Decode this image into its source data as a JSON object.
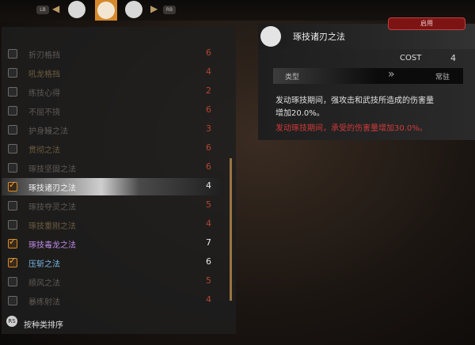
{
  "topbar": {
    "lb_label": "LB",
    "rb_label": "RB",
    "left_arrow": "◀",
    "right_arrow": "▶"
  },
  "skills": [
    {
      "name": "折刃格挡",
      "cost": "6",
      "checked": false
    },
    {
      "name": "吼龙格挡",
      "cost": "4",
      "checked": false
    },
    {
      "name": "练技心得",
      "cost": "2",
      "checked": false
    },
    {
      "name": "不屈不挠",
      "cost": "6",
      "checked": false
    },
    {
      "name": "护身鳗之法",
      "cost": "3",
      "checked": false
    },
    {
      "name": "贯彻之法",
      "cost": "6",
      "checked": false
    },
    {
      "name": "琢技坚固之法",
      "cost": "6",
      "checked": false
    },
    {
      "name": "琢技诸刃之法",
      "cost": "4",
      "checked": true
    },
    {
      "name": "琢技夺灵之法",
      "cost": "5",
      "checked": false
    },
    {
      "name": "琢技重刚之法",
      "cost": "4",
      "checked": false
    },
    {
      "name": "琢技毒龙之法",
      "cost": "7",
      "checked": true
    },
    {
      "name": "压斩之法",
      "cost": "6",
      "checked": true
    },
    {
      "name": "顺风之法",
      "cost": "5",
      "checked": false
    },
    {
      "name": "暴练射法",
      "cost": "4",
      "checked": false
    }
  ],
  "sort": {
    "button": "RS",
    "label": "按种类排序"
  },
  "detail": {
    "title": "琢技诸刃之法",
    "enable_label": "启用",
    "cost_label": "COST",
    "cost_value": "4",
    "type_label": "类型",
    "type_value": "常驻",
    "desc_line1": "发动琢技期间，强攻击和武技所造成的伤害量",
    "desc_line2": "增加20.0%。",
    "desc_red": "发动琢技期间，承受的伤害量增加30.0%。"
  }
}
